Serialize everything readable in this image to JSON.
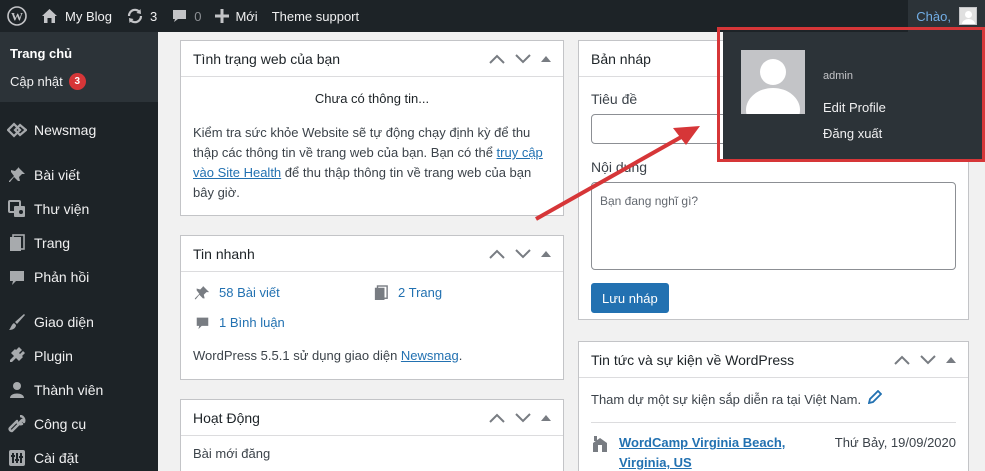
{
  "adminbar": {
    "site_name": "My Blog",
    "updates_count": "3",
    "comments_count": "0",
    "new_label": "Mới",
    "theme_support_label": "Theme support",
    "greeting": "Chào,"
  },
  "sidebar": {
    "home_label": "Trang chủ",
    "updates_label": "Cập nhật",
    "updates_badge": "3",
    "items": [
      {
        "label": "Newsmag",
        "icon": "newsmag-icon"
      },
      {
        "label": "Bài viết",
        "icon": "pin-icon"
      },
      {
        "label": "Thư viện",
        "icon": "media-icon"
      },
      {
        "label": "Trang",
        "icon": "page-icon"
      },
      {
        "label": "Phản hồi",
        "icon": "comment-icon"
      },
      {
        "label": "Giao diện",
        "icon": "brush-icon"
      },
      {
        "label": "Plugin",
        "icon": "plugin-icon"
      },
      {
        "label": "Thành viên",
        "icon": "users-icon"
      },
      {
        "label": "Công cụ",
        "icon": "wrench-icon"
      },
      {
        "label": "Cài đặt",
        "icon": "settings-icon"
      }
    ]
  },
  "site_health": {
    "title": "Tình trạng web của bạn",
    "no_info": "Chưa có thông tin...",
    "text_before": "Kiểm tra sức khỏe Website sẽ tự động chạy định kỳ để thu thập các thông tin về trang web của bạn. Bạn có thể ",
    "link": "truy cập vào Site Health",
    "text_after": " để thu thập thông tin về trang web của bạn bây giờ."
  },
  "at_a_glance": {
    "title": "Tin nhanh",
    "posts": "58 Bài viết",
    "pages": "2 Trang",
    "comments": "1 Bình luận",
    "footer_before": "WordPress 5.5.1 sử dụng giao diện ",
    "theme_link": "Newsmag",
    "footer_after": "."
  },
  "activity": {
    "title": "Hoạt Động",
    "recent": "Bài mới đăng"
  },
  "quick_draft": {
    "title": "Bản nháp",
    "title_label": "Tiêu đề",
    "content_label": "Nội dung",
    "content_placeholder": "Bạn đang nghĩ gì?",
    "save_label": "Lưu nháp"
  },
  "news": {
    "title": "Tin tức và sự kiện về WordPress",
    "intro": "Tham dự một sự kiện sắp diễn ra tại Việt Nam.",
    "event_title": "WordCamp Virginia Beach, Virginia, US",
    "event_date": "Thứ Bảy, 19/09/2020"
  },
  "profile": {
    "username": "admin",
    "edit_profile": "Edit Profile",
    "logout": "Đăng xuất"
  },
  "colors": {
    "adminbar": "#1d2327",
    "accent": "#2271b1",
    "badge": "#d63638",
    "highlight_box": "#d63638"
  }
}
